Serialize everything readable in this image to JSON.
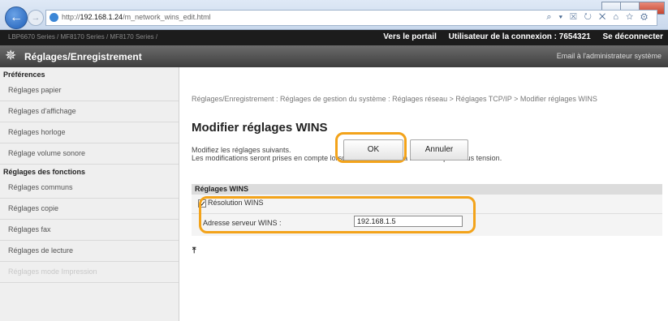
{
  "browser": {
    "url_prefix": "http://",
    "url_host": "192.168.1.24",
    "url_path": "/m_network_wins_edit.html",
    "toolbar_icons": "⌕ ▾ ☒ ↻ ✕ ⌂ ☆ ⚙"
  },
  "topbar": {
    "device_info": "LBP6670 Series / MF8170 Series / MF8170 Series /",
    "portal_link": "Vers le portail",
    "user_label": "Utilisateur de la connexion : 7654321",
    "logout_link": "Se déconnecter"
  },
  "appbar": {
    "title": "Réglages/Enregistrement",
    "email_link": "Email à l'administrateur système"
  },
  "sidebar": {
    "section1": "Préférences",
    "items1": [
      "Réglages papier",
      "Réglages d'affichage",
      "Réglages horloge",
      "Réglage volume sonore"
    ],
    "section2": "Réglages des fonctions",
    "items2": [
      "Réglages communs",
      "Réglages copie",
      "Réglages fax",
      "Réglages de lecture",
      "Réglages mode Impression"
    ]
  },
  "main": {
    "breadcrumb": "Réglages/Enregistrement : Réglages de gestion du système : Réglages réseau > Réglages TCP/IP > Modifier réglages WINS",
    "page_title": "Modifier réglages WINS",
    "desc_line1": "Modifiez les réglages suivants.",
    "desc_line2": "Les modifications seront prises en compte lorsque la machine sera mise hors puis sous tension.",
    "ok_label": "OK",
    "cancel_label": "Annuler"
  },
  "wins": {
    "section_title": "Réglages WINS",
    "resolution_label": "Résolution WINS",
    "resolution_checked": true,
    "server_label": "Adresse serveur WINS :",
    "server_value": "192.168.1.5"
  },
  "colors": {
    "highlight": "#f3a31a",
    "topbar_bg": "#1c1c1c",
    "appbar_bg": "#4a4a4a"
  },
  "to_top_symbol": "⤒"
}
